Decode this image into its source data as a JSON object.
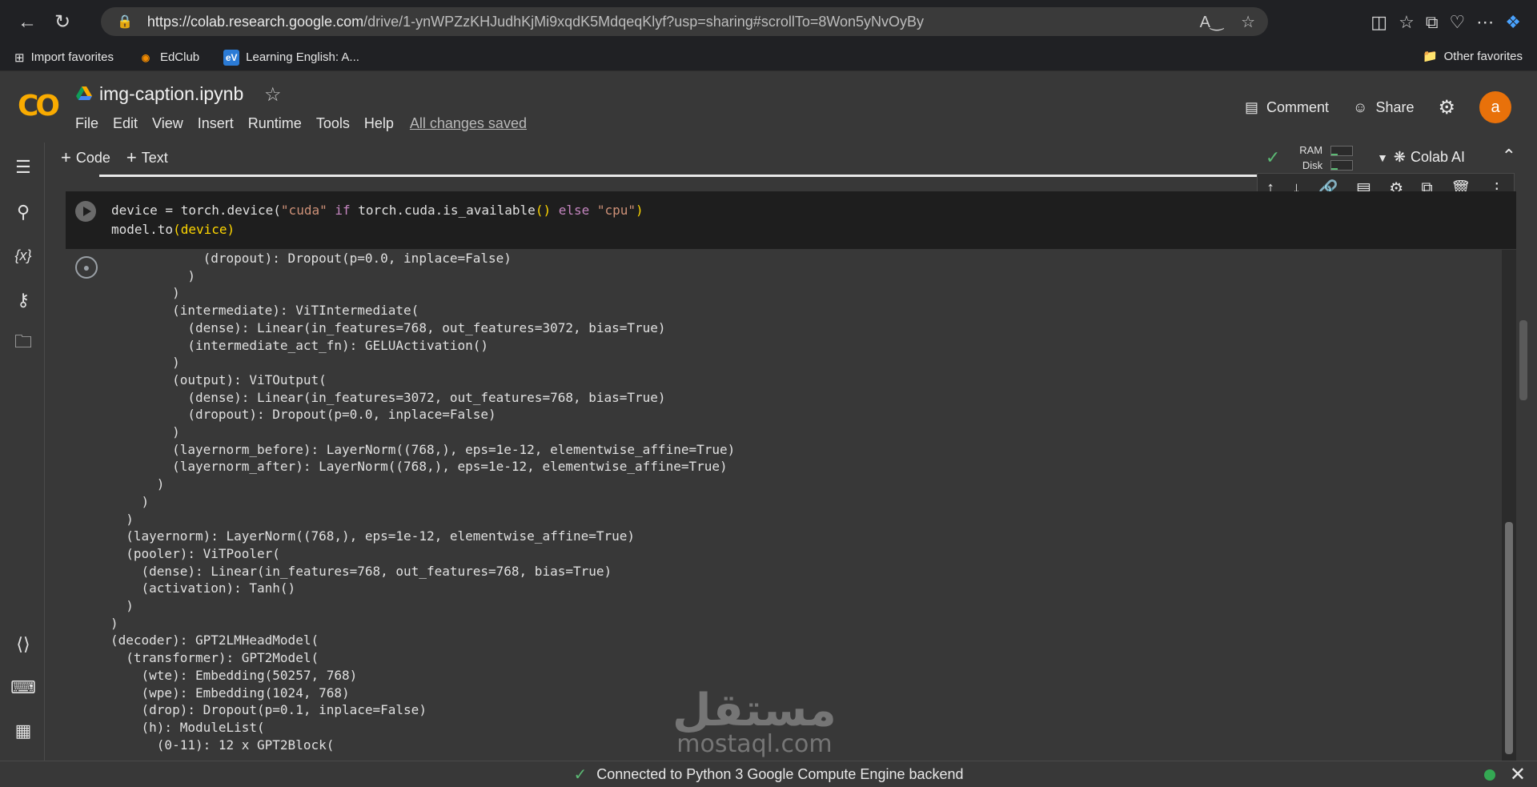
{
  "browser": {
    "url_host": "https://colab.research.google.com",
    "url_path": "/drive/1-ynWPZzKHJudhKjMi9xqdK5MdqeqKlyf?usp=sharing#scrollTo=8Won5yNvOyBy"
  },
  "favorites": {
    "items": [
      "Import favorites",
      "EdClub",
      "Learning English: A..."
    ],
    "other": "Other favorites"
  },
  "colab": {
    "logo": "CO",
    "notebook_title": "img-caption.ipynb",
    "menu": [
      "File",
      "Edit",
      "View",
      "Insert",
      "Runtime",
      "Tools",
      "Help"
    ],
    "save_status": "All changes saved",
    "comment_label": "Comment",
    "share_label": "Share",
    "avatar_letter": "a"
  },
  "toolbar": {
    "code_label": "Code",
    "text_label": "Text",
    "ram_label": "RAM",
    "disk_label": "Disk",
    "colab_ai_label": "Colab AI"
  },
  "cell": {
    "line1_a": "device = torch.device(",
    "line1_b": "\"cuda\"",
    "line1_c": " if ",
    "line1_d": "torch.cuda.is_available",
    "line1_e": "() ",
    "line1_f": "else",
    "line1_g": " \"cpu\"",
    "line1_h": ")",
    "line2_a": "model.to",
    "line2_b": "(device)"
  },
  "output_lines": [
    "            (dropout): Dropout(p=0.0, inplace=False)",
    "          )",
    "        )",
    "        (intermediate): ViTIntermediate(",
    "          (dense): Linear(in_features=768, out_features=3072, bias=True)",
    "          (intermediate_act_fn): GELUActivation()",
    "        )",
    "        (output): ViTOutput(",
    "          (dense): Linear(in_features=3072, out_features=768, bias=True)",
    "          (dropout): Dropout(p=0.0, inplace=False)",
    "        )",
    "        (layernorm_before): LayerNorm((768,), eps=1e-12, elementwise_affine=True)",
    "        (layernorm_after): LayerNorm((768,), eps=1e-12, elementwise_affine=True)",
    "      )",
    "    )",
    "  )",
    "  (layernorm): LayerNorm((768,), eps=1e-12, elementwise_affine=True)",
    "  (pooler): ViTPooler(",
    "    (dense): Linear(in_features=768, out_features=768, bias=True)",
    "    (activation): Tanh()",
    "  )",
    ")",
    "(decoder): GPT2LMHeadModel(",
    "  (transformer): GPT2Model(",
    "    (wte): Embedding(50257, 768)",
    "    (wpe): Embedding(1024, 768)",
    "    (drop): Dropout(p=0.1, inplace=False)",
    "    (h): ModuleList(",
    "      (0-11): 12 x GPT2Block("
  ],
  "watermark": {
    "arabic": "مستقل",
    "latin": "mostaql.com"
  },
  "status": {
    "text": "Connected to Python 3 Google Compute Engine backend"
  }
}
